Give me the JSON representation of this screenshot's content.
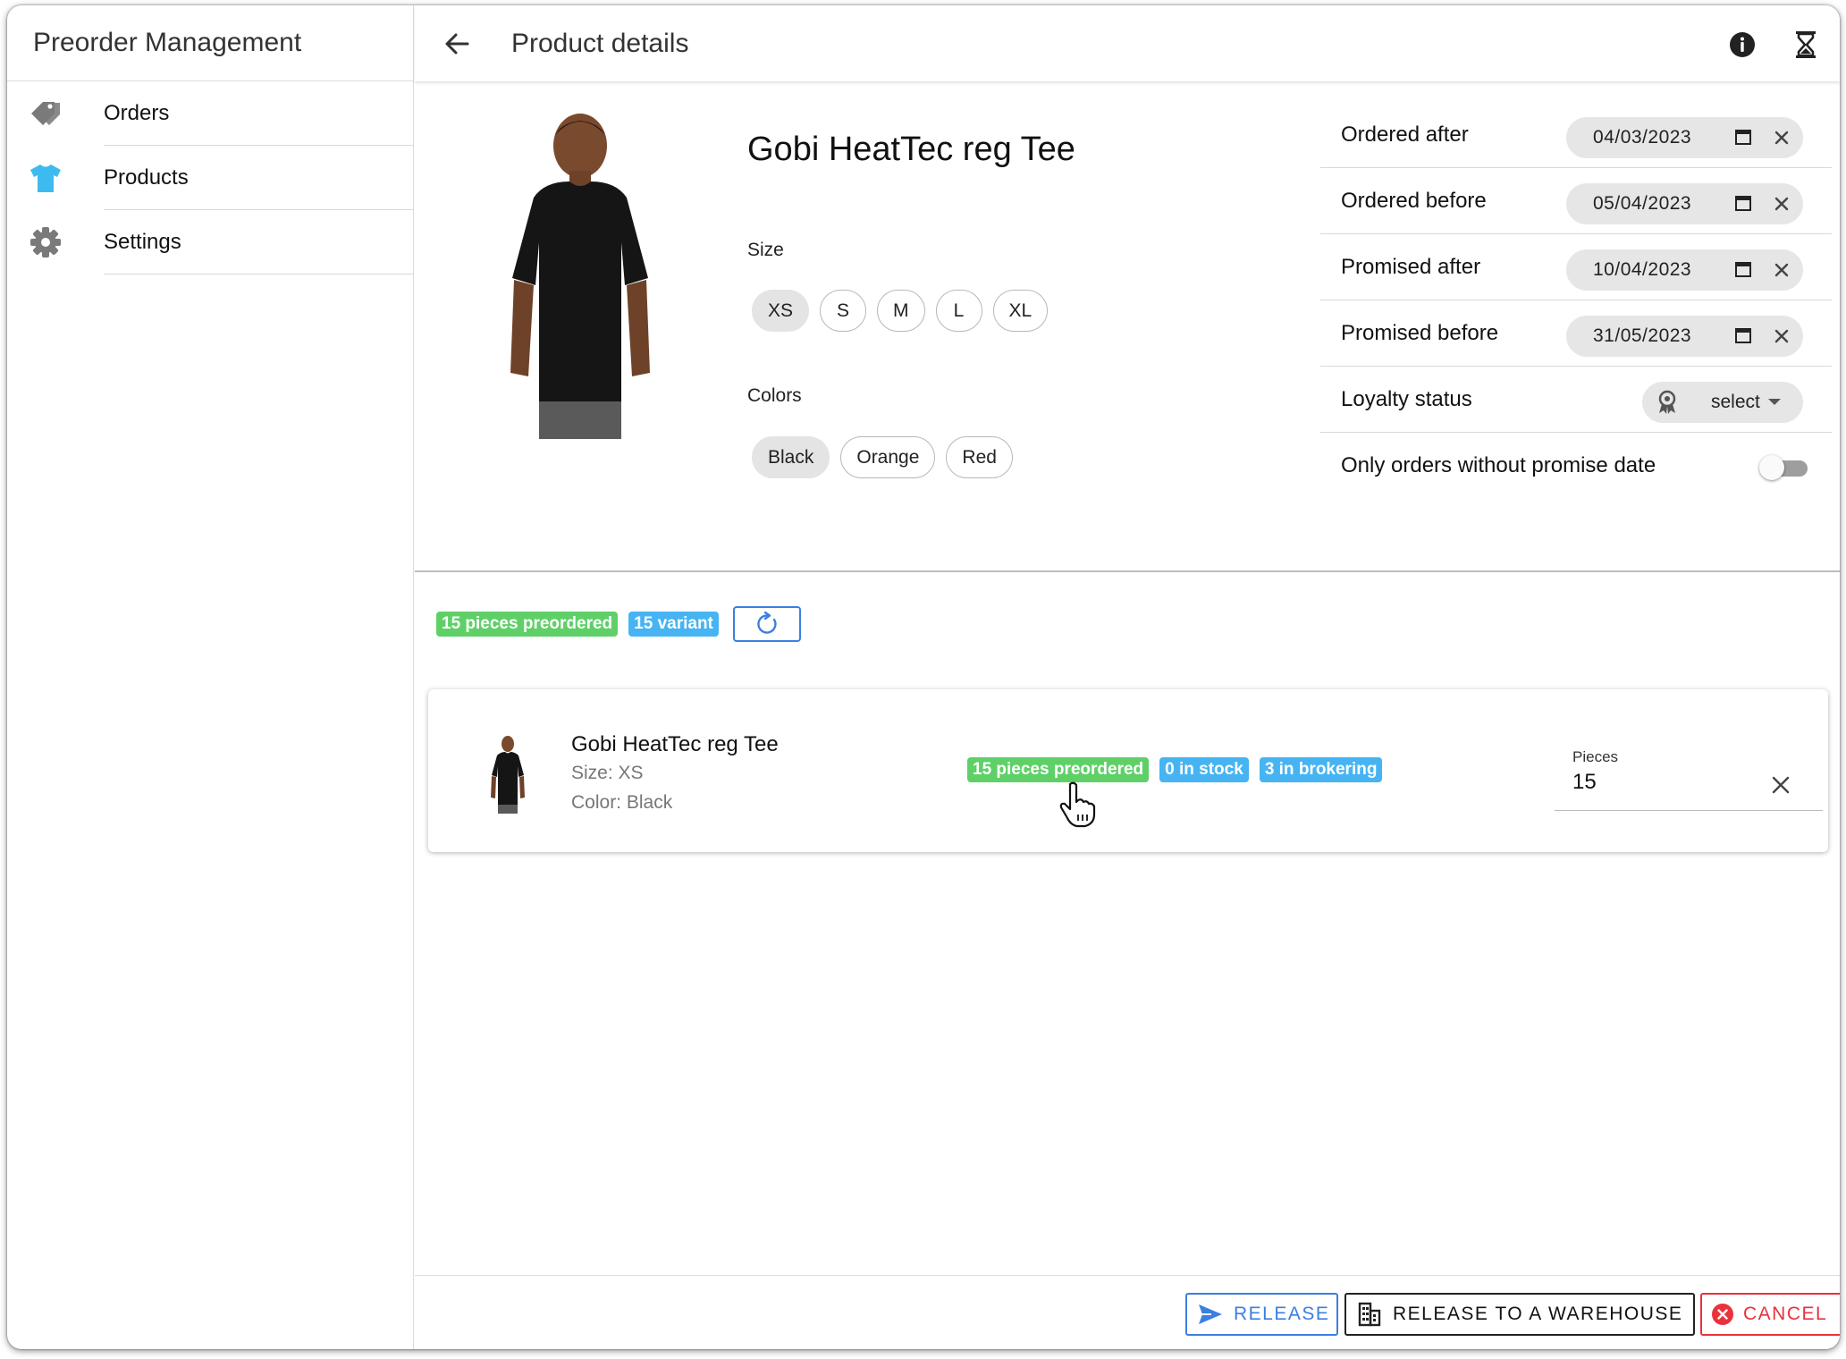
{
  "app": {
    "title": "Preorder Management"
  },
  "sidebar": {
    "items": [
      {
        "label": "Orders",
        "icon": "pricetags-icon",
        "color": "#7a7a7a"
      },
      {
        "label": "Products",
        "icon": "shirt-icon",
        "color": "#3dbbf0"
      },
      {
        "label": "Settings",
        "icon": "settings-icon",
        "color": "#7a7a7a"
      }
    ]
  },
  "toolbar": {
    "title": "Product details"
  },
  "product": {
    "title": "Gobi HeatTec reg Tee",
    "size_label": "Size",
    "sizes": [
      {
        "label": "XS",
        "selected": true
      },
      {
        "label": "S",
        "selected": false
      },
      {
        "label": "M",
        "selected": false
      },
      {
        "label": "L",
        "selected": false
      },
      {
        "label": "XL",
        "selected": false
      }
    ],
    "colors_label": "Colors",
    "colors": [
      {
        "label": "Black",
        "selected": true
      },
      {
        "label": "Orange",
        "selected": false
      },
      {
        "label": "Red",
        "selected": false
      }
    ]
  },
  "filters": {
    "ordered_after": {
      "label": "Ordered after",
      "value": "04/03/2023"
    },
    "ordered_before": {
      "label": "Ordered before",
      "value": "05/04/2023"
    },
    "promised_after": {
      "label": "Promised after",
      "value": "10/04/2023"
    },
    "promised_before": {
      "label": "Promised before",
      "value": "31/05/2023"
    },
    "loyalty": {
      "label": "Loyalty status",
      "value": "select"
    },
    "no_promise": {
      "label": "Only orders without promise date",
      "enabled": false
    }
  },
  "summary": {
    "preordered": "15 pieces preordered",
    "variants": "15 variant"
  },
  "variant": {
    "name": "Gobi HeatTec reg Tee",
    "size": "Size: XS",
    "color": "Color: Black",
    "badge_preordered": "15 pieces preordered",
    "badge_stock": "0 in stock",
    "badge_brokering": "3 in brokering",
    "pieces_label": "Pieces",
    "pieces_value": "15"
  },
  "footer": {
    "release": "RELEASE",
    "release_warehouse": "RELEASE TO A WAREHOUSE",
    "cancel": "CANCEL"
  },
  "colors": {
    "primary": "#3b7fe0",
    "success": "#5fd068",
    "info": "#46b4f2",
    "danger": "#e8323c"
  }
}
